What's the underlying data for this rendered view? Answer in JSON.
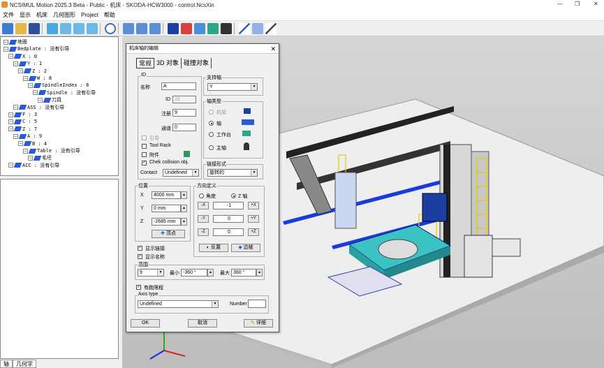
{
  "window": {
    "title": "NCSIMUL Motion 2025.3 Beta - Public - 机床 - SKODA-HCW3000 - control.NcsXin",
    "min": "—",
    "restore": "❐",
    "close": "✕"
  },
  "menu": [
    "文件",
    "显示",
    "机床",
    "几何图形",
    "Project",
    "帮助"
  ],
  "tree": [
    {
      "text": "地面",
      "indent": 0
    },
    {
      "text": "Bedplate : 没有引导",
      "indent": 0
    },
    {
      "text": "X : 0",
      "indent": 1
    },
    {
      "text": "Y : 1",
      "indent": 2
    },
    {
      "text": "Z : 2",
      "indent": 3
    },
    {
      "text": "W : 8",
      "indent": 4
    },
    {
      "text": "SpindleIndex : 6",
      "indent": 5
    },
    {
      "text": "Spindle : 没有引导",
      "indent": 6
    },
    {
      "text": "刀具",
      "indent": 7
    },
    {
      "text": "ASS : 没有引导",
      "indent": 2
    },
    {
      "text": "F : 3",
      "indent": 1
    },
    {
      "text": "C : 5",
      "indent": 1
    },
    {
      "text": "Z : 7",
      "indent": 1
    },
    {
      "text": "A : 9",
      "indent": 2
    },
    {
      "text": "B : 4",
      "indent": 3
    },
    {
      "text": "Table : 没有引导",
      "indent": 4
    },
    {
      "text": "毛坯",
      "indent": 5
    },
    {
      "text": "ACC : 没有引导",
      "indent": 1
    }
  ],
  "bottom_tabs": [
    "轴",
    "几何学"
  ],
  "dialog": {
    "title": "机床轴的编辑",
    "close": "✕",
    "tabs": [
      "常规",
      "3D 对象",
      "碰撞对象"
    ],
    "id_group": "ID",
    "name_label": "名称",
    "name_value": "A",
    "id_label": "ID",
    "id_value": "15",
    "reg_label": "注册",
    "reg_value": "9",
    "channel_label": "通道",
    "channel_value": "0",
    "guide_label": "引导",
    "toolrack_label": "Tool Rack",
    "attach_label": "附件",
    "collision_label": "Chek collision obj.",
    "contact_label": "Contact",
    "contact_value": "Undefined",
    "support_group": "支持轴",
    "support_value": "Y",
    "type_group": "轴类型",
    "type_options": [
      "机架",
      "轴",
      "工作台",
      "主轴"
    ],
    "link_group": "链接形式",
    "link_value": "旋转的",
    "pos_group": "位置",
    "x_label": "X",
    "x_value": "4000 mm",
    "y_label": "Y",
    "y_value": "0 mm",
    "z_label": "Z",
    "z_value": "-2685 mm",
    "vertex_btn": "顶点",
    "dir_group": "方向定义",
    "angle_label": "角度",
    "zaxis_label": "Z 轴",
    "dir_rows": [
      {
        "neg": "-X",
        "val": "-1",
        "pos": "+X"
      },
      {
        "neg": "-Y",
        "val": "0",
        "pos": "+Y"
      },
      {
        "neg": "-Z",
        "val": "0",
        "pos": "+Z"
      }
    ],
    "reverse_btn": "反置",
    "edge_btn": "边棱",
    "show_link": "显示链接",
    "show_name": "显示名称",
    "range_group": "范围",
    "range_sel": "9",
    "min_label": "最小",
    "min_value": "-360 °",
    "max_label": "最大",
    "max_value": "360 °",
    "limit_label": "有跑限程",
    "axis_type_group": "Axis type",
    "axis_type_value": "Undefined",
    "number_label": "Number",
    "number_value": "",
    "ok": "OK",
    "cancel": "取消",
    "detail": "详细"
  }
}
